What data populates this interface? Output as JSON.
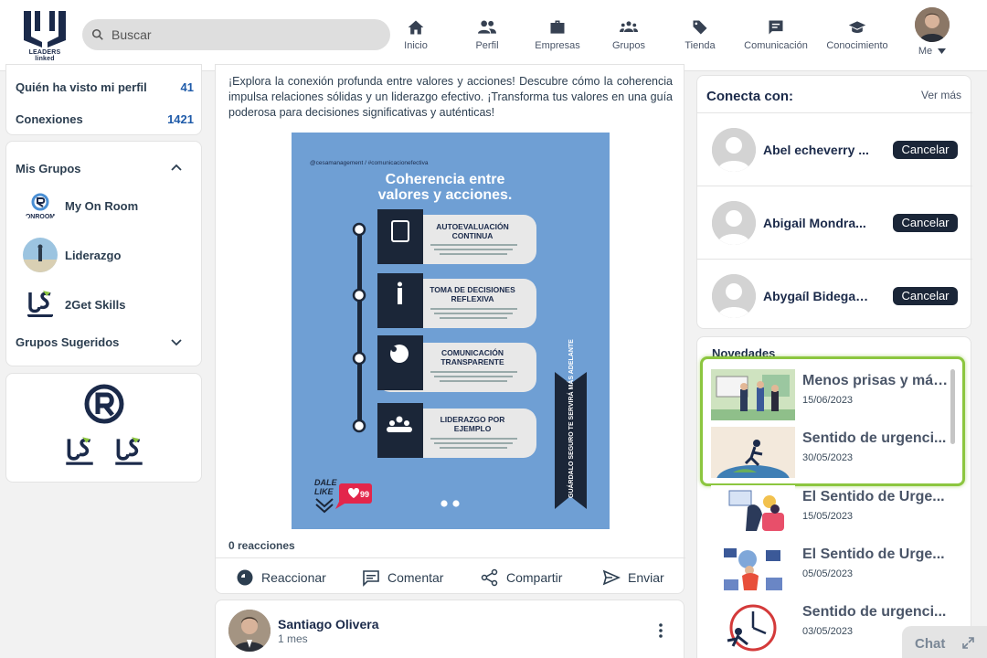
{
  "navbar": {
    "logo_text": "LEADERS linked",
    "search_placeholder": "Buscar",
    "items": [
      {
        "label": "Inicio",
        "icon": "home-icon"
      },
      {
        "label": "Perfil",
        "icon": "people-icon"
      },
      {
        "label": "Empresas",
        "icon": "briefcase-icon"
      },
      {
        "label": "Grupos",
        "icon": "groups-icon"
      },
      {
        "label": "Tienda",
        "icon": "tag-icon"
      },
      {
        "label": "Comunicación",
        "icon": "message-icon"
      },
      {
        "label": "Conocimiento",
        "icon": "graduation-cap-icon"
      }
    ],
    "me_label": "Me"
  },
  "stats": {
    "views_label": "Quién ha visto mi perfil",
    "views_count": "41",
    "connections_label": "Conexiones",
    "connections_count": "1421"
  },
  "groups": {
    "title": "Mis Grupos",
    "items": [
      {
        "label": "My On Room"
      },
      {
        "label": "Liderazgo"
      },
      {
        "label": "2Get Skills"
      }
    ],
    "suggested_title": "Grupos Sugeridos"
  },
  "post": {
    "text": "¡Explora la conexión profunda entre valores y acciones! Descubre cómo la coherencia impulsa relaciones sólidas y un liderazgo efectivo. ¡Transforma tus valores en una guía poderosa para decisiones significativas y auténticas!",
    "infographic": {
      "handle": "@cesamanagement / #comunicacionefectiva",
      "title_line1": "Coherencia entre",
      "title_line2": "valores y acciones.",
      "steps": [
        {
          "title1": "AUTOEVALUACIÓN",
          "title2": "CONTINUA"
        },
        {
          "title1": "TOMA DE DECISIONES",
          "title2": "REFLEXIVA"
        },
        {
          "title1": "COMUNICACIÓN",
          "title2": "TRANSPARENTE"
        },
        {
          "title1": "LIDERAZGO POR",
          "title2": "EJEMPLO"
        }
      ],
      "side_banner": "GUÁRDALO SEGURO TE SERVIRÁ MÁS ADELANTE",
      "dale_like_1": "DALE",
      "dale_like_2": "LIKE",
      "like_count": "99"
    },
    "reactions_count": "0 reacciones",
    "actions": {
      "react": "Reaccionar",
      "comment": "Comentar",
      "share": "Compartir",
      "send": "Enviar"
    }
  },
  "next_post": {
    "author": "Santiago Olivera",
    "time": "1 mes"
  },
  "connect": {
    "title": "Conecta con:",
    "see_more": "Ver más",
    "people": [
      {
        "name": "Abel echeverry ...",
        "button": "Cancelar"
      },
      {
        "name": "Abigail Mondra...",
        "button": "Cancelar"
      },
      {
        "name": "Abygaíl Bidegaray",
        "button": "Cancelar"
      }
    ]
  },
  "news": {
    "title": "Novedades",
    "items": [
      {
        "title": "Menos prisas y más...",
        "date": "15/06/2023"
      },
      {
        "title": "Sentido de urgenci...",
        "date": "30/05/2023"
      },
      {
        "title": "El Sentido de Urge...",
        "date": "15/05/2023"
      },
      {
        "title": "El Sentido de Urge...",
        "date": "05/05/2023"
      },
      {
        "title": "Sentido de urgenci...",
        "date": "03/05/2023"
      }
    ]
  },
  "chat": {
    "label": "Chat"
  },
  "colors": {
    "accent": "#1f5ba9",
    "highlight": "#8cc63f",
    "button_dark": "#1b2638",
    "infographic_bg": "#6f9fd4"
  }
}
